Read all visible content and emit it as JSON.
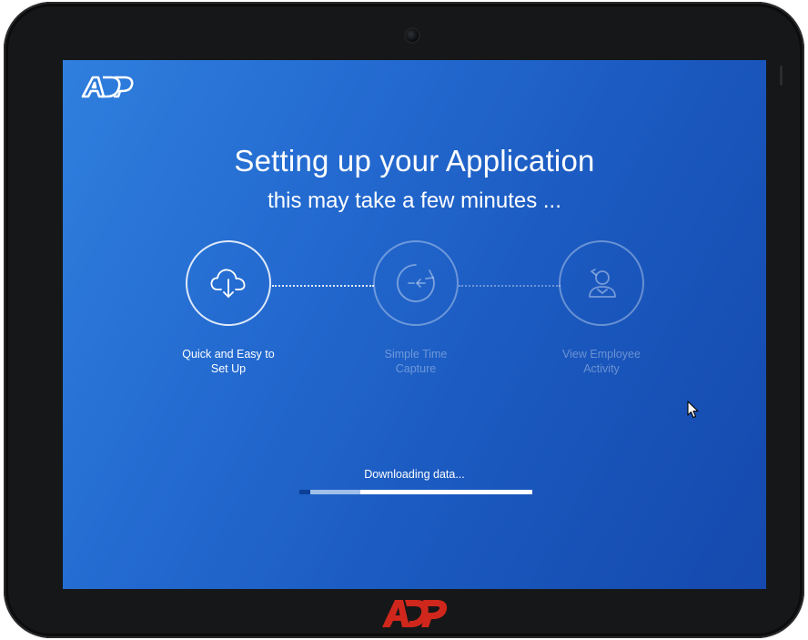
{
  "brand": {
    "name": "ADP",
    "logo_screen": "adp-logo-white",
    "logo_bezel": "adp-logo-red",
    "red": "#d0271d"
  },
  "colors": {
    "screen_gradient_start": "#2f7fde",
    "screen_gradient_end": "#1549ad",
    "progress_remaining": "#ffffff",
    "progress_done": "#9fc0e9"
  },
  "setup": {
    "title": "Setting up your Application",
    "subtitle": "this may take a few minutes ...",
    "steps": [
      {
        "label_line1": "Quick and Easy to",
        "label_line2": "Set Up",
        "icon": "cloud-download-icon",
        "active": true
      },
      {
        "label_line1": "Simple Time",
        "label_line2": "Capture",
        "icon": "clock-arrow-icon",
        "active": false
      },
      {
        "label_line1": "View Employee",
        "label_line2": "Activity",
        "icon": "employee-icon",
        "active": false
      }
    ]
  },
  "progress": {
    "status": "Downloading data...",
    "fraction": 0.26
  }
}
